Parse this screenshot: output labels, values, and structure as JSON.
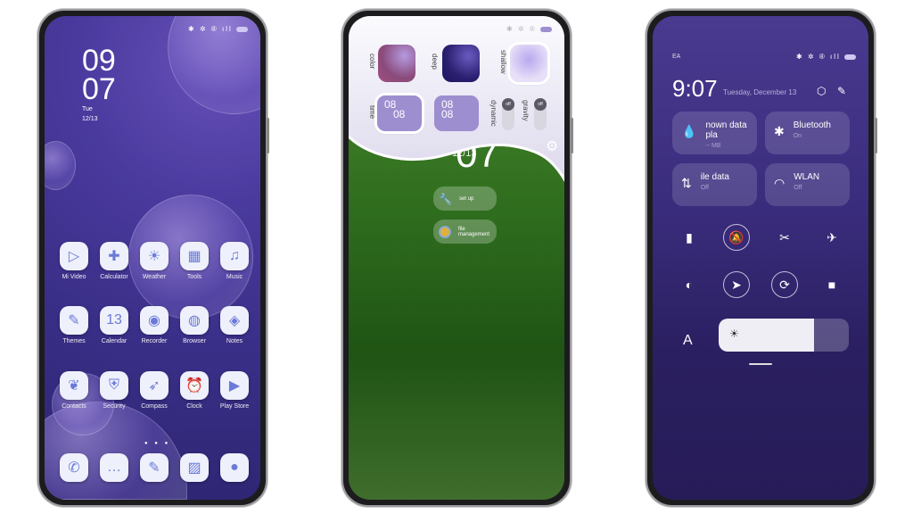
{
  "home": {
    "status_icons": "✱ ✲ ® ıll",
    "clock_hour": "09",
    "clock_minute": "07",
    "day": "Tue",
    "date": "12/13",
    "apps": [
      {
        "label": "Mi Video",
        "icon": "▷"
      },
      {
        "label": "Calculator",
        "icon": "✚"
      },
      {
        "label": "Weather",
        "icon": "☀"
      },
      {
        "label": "Tools",
        "icon": "▦"
      },
      {
        "label": "Music",
        "icon": "♫"
      },
      {
        "label": "Themes",
        "icon": "✎"
      },
      {
        "label": "Calendar",
        "icon": "13"
      },
      {
        "label": "Recorder",
        "icon": "◉"
      },
      {
        "label": "Browser",
        "icon": "◍"
      },
      {
        "label": "Notes",
        "icon": "◈"
      },
      {
        "label": "Contacts",
        "icon": "❦"
      },
      {
        "label": "Security",
        "icon": "⛨"
      },
      {
        "label": "Compass",
        "icon": "➶"
      },
      {
        "label": "Clock",
        "icon": "⏰"
      },
      {
        "label": "Play Store",
        "icon": "▶"
      }
    ],
    "dock": [
      {
        "icon": "✆",
        "name": "phone"
      },
      {
        "icon": "…",
        "name": "messages"
      },
      {
        "icon": "✎",
        "name": "themes-tool"
      },
      {
        "icon": "▨",
        "name": "gallery"
      },
      {
        "icon": "●",
        "name": "camera"
      }
    ]
  },
  "theme_settings": {
    "labels": {
      "color": "color",
      "deep": "deep",
      "shallow": "shallow",
      "time": "time",
      "dynamic": "dynamic",
      "gravity": "gravity"
    },
    "time_tile_1": {
      "top": "08",
      "bottom": "08"
    },
    "time_tile_2": {
      "top": "08",
      "bottom": "08"
    },
    "toggle_dynamic": "off",
    "toggle_gravity": "off",
    "date": "12/13",
    "clock_minute": "07",
    "buttons": {
      "setup": "set up",
      "file": "file management"
    }
  },
  "control_center": {
    "carrier": "EA",
    "time": "9:07",
    "date": "Tuesday, December 13",
    "tiles": [
      {
        "title": "nown data pla",
        "sub": "-- MB",
        "icon": "💧"
      },
      {
        "title": "Bluetooth",
        "sub": "On",
        "icon": "✱"
      },
      {
        "title": "ile data",
        "sub": "Off",
        "icon": "⇅"
      },
      {
        "title": "WLAN",
        "sub": "Off",
        "icon": "◠"
      }
    ],
    "toggles": [
      {
        "name": "flashlight",
        "icon": "▮"
      },
      {
        "name": "mute",
        "icon": "🔕"
      },
      {
        "name": "screenshot",
        "icon": "✂"
      },
      {
        "name": "airplane",
        "icon": "✈"
      },
      {
        "name": "dark-mode",
        "icon": "◐"
      },
      {
        "name": "location",
        "icon": "➤"
      },
      {
        "name": "rotation-lock",
        "icon": "⟳"
      },
      {
        "name": "screen-record",
        "icon": "■"
      }
    ],
    "font_label": "A",
    "brightness_percent": 73
  }
}
